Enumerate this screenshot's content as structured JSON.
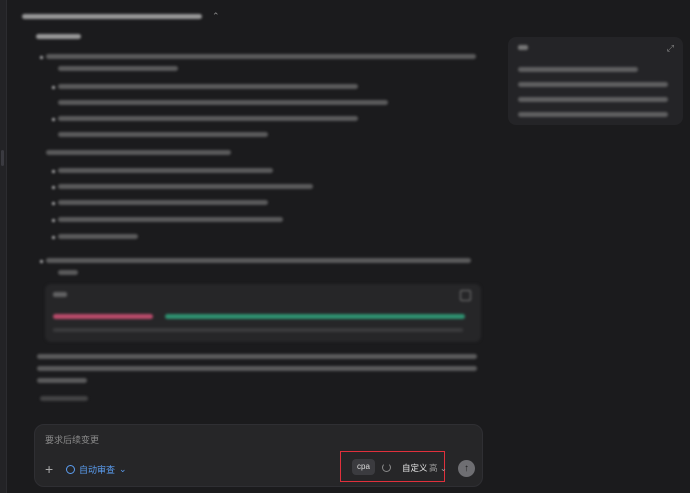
{
  "topbar": {
    "title": "",
    "caret": "⌃"
  },
  "side_panel": {
    "expand_icon": "⤢"
  },
  "composer": {
    "placeholder": "要求后续变更",
    "plus": "+",
    "auto_review_label": "自动审查",
    "auto_review_caret": "⌄",
    "model_chip": "cpa",
    "custom_label": "自定义",
    "level_label": "高",
    "level_caret": "⌄",
    "send_icon": "↑"
  }
}
